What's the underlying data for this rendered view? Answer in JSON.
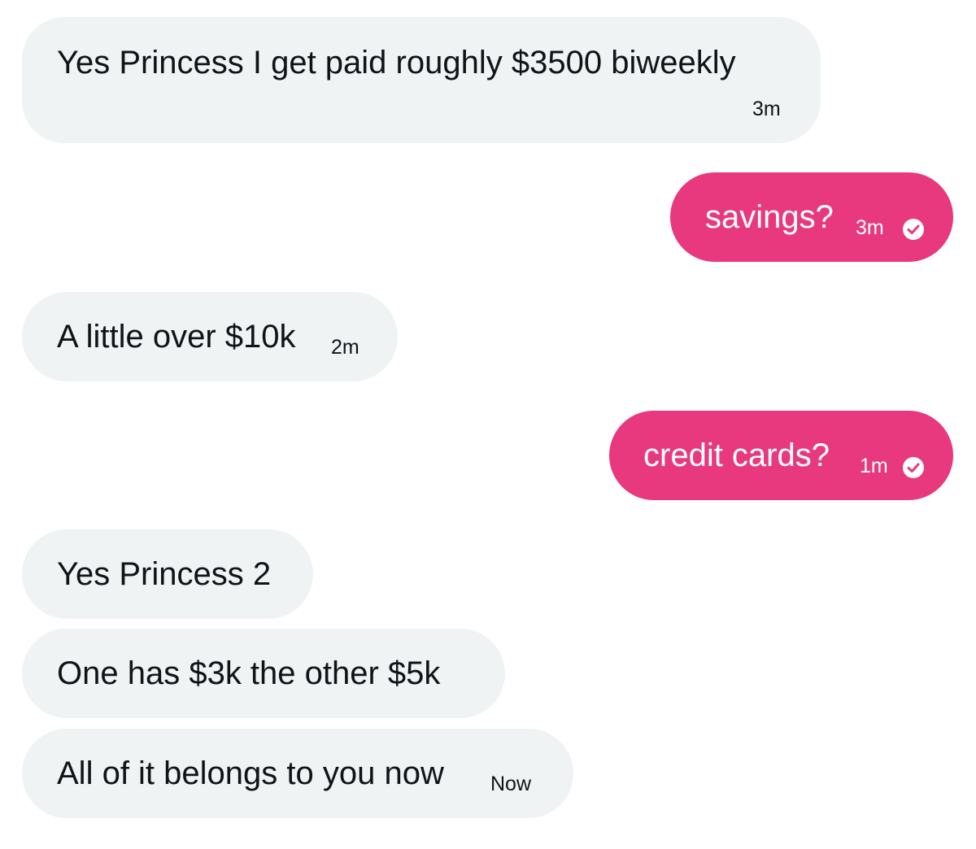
{
  "conversation": {
    "messages": [
      {
        "direction": "received",
        "text": "Yes Princess I get paid roughly $3500 biweekly",
        "time": "3m"
      },
      {
        "direction": "sent",
        "text": "savings?",
        "time": "3m",
        "status_icon": "check-circle-icon"
      },
      {
        "direction": "received",
        "text": "A little over $10k",
        "time": "2m"
      },
      {
        "direction": "sent",
        "text": "credit cards?",
        "time": "1m",
        "status_icon": "check-circle-icon"
      },
      {
        "direction": "received",
        "text": "Yes Princess 2",
        "time": ""
      },
      {
        "direction": "received",
        "text": "One has $3k the other $5k",
        "time": ""
      },
      {
        "direction": "received",
        "text": "All of it belongs to you now",
        "time": "Now"
      }
    ]
  },
  "colors": {
    "received_bubble": "#eff3f4",
    "sent_bubble": "#e8387e",
    "received_text": "#0f1419",
    "sent_text": "#ffffff"
  }
}
